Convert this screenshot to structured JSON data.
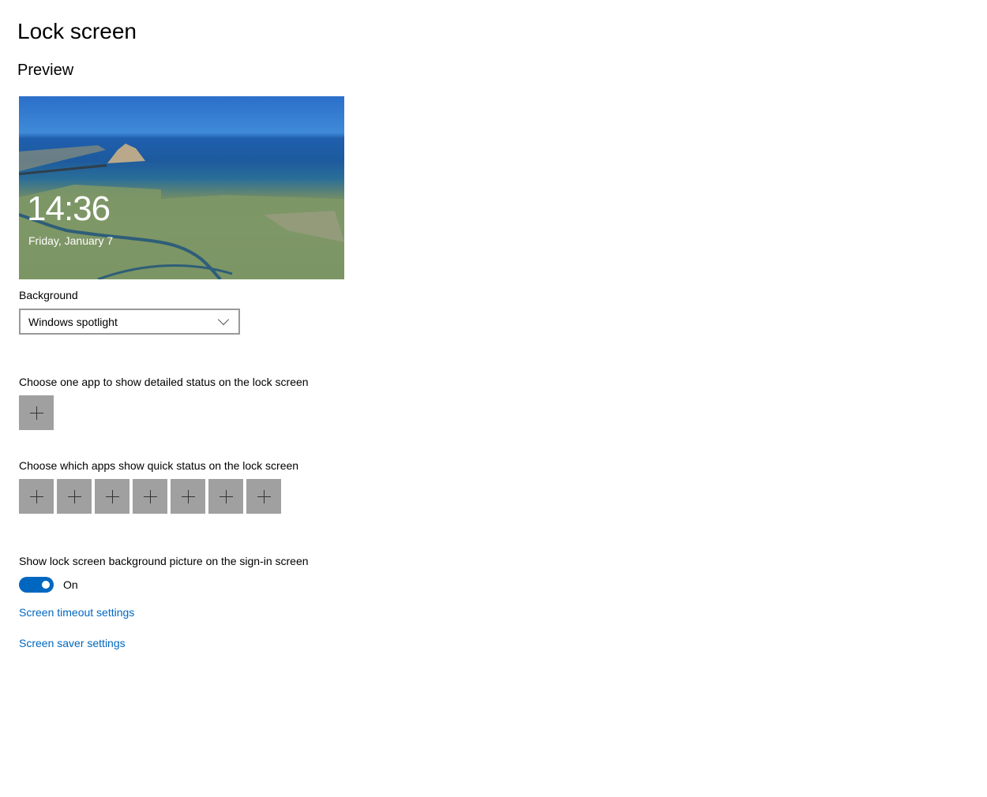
{
  "page": {
    "title": "Lock screen",
    "preview_heading": "Preview"
  },
  "preview": {
    "time": "14:36",
    "date": "Friday, January 7"
  },
  "background": {
    "label": "Background",
    "selected": "Windows spotlight"
  },
  "detailed_status": {
    "label": "Choose one app to show detailed status on the lock screen",
    "tile_count": 1
  },
  "quick_status": {
    "label": "Choose which apps show quick status on the lock screen",
    "tile_count": 7
  },
  "signin": {
    "label": "Show lock screen background picture on the sign-in screen",
    "state": "On",
    "enabled": true
  },
  "links": {
    "timeout": "Screen timeout settings",
    "saver": "Screen saver settings"
  },
  "colors": {
    "accent": "#0067c0",
    "tile": "#a0a0a0"
  }
}
